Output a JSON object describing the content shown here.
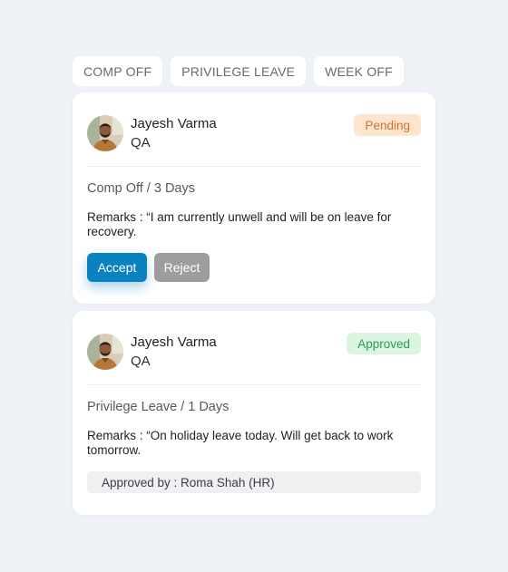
{
  "tabs": [
    {
      "label": "COMP OFF"
    },
    {
      "label": "PRIVILEGE LEAVE"
    },
    {
      "label": "WEEK OFF"
    }
  ],
  "requests": [
    {
      "name": "Jayesh Varma",
      "role": "QA",
      "status": "Pending",
      "leave_type": "Comp Off / 3 Days",
      "remarks": "Remarks : “I am currently unwell and will be on leave for recovery.",
      "accept_label": "Accept",
      "reject_label": "Reject"
    },
    {
      "name": "Jayesh Varma",
      "role": "QA",
      "status": "Approved",
      "leave_type": "Privilege Leave / 1 Days",
      "remarks": "Remarks : “On holiday leave today. Will get back to work tomorrow.",
      "approved_by": "Approved by : Roma Shah (HR)"
    }
  ],
  "colors": {
    "accent": "#0b82c0",
    "pending_bg": "#fde5cf",
    "pending_text": "#d2742d",
    "approved_bg": "#dcf5e3",
    "approved_text": "#2f9a4f",
    "reject": "#9d9d9d",
    "page_bg": "#eef2f6"
  }
}
